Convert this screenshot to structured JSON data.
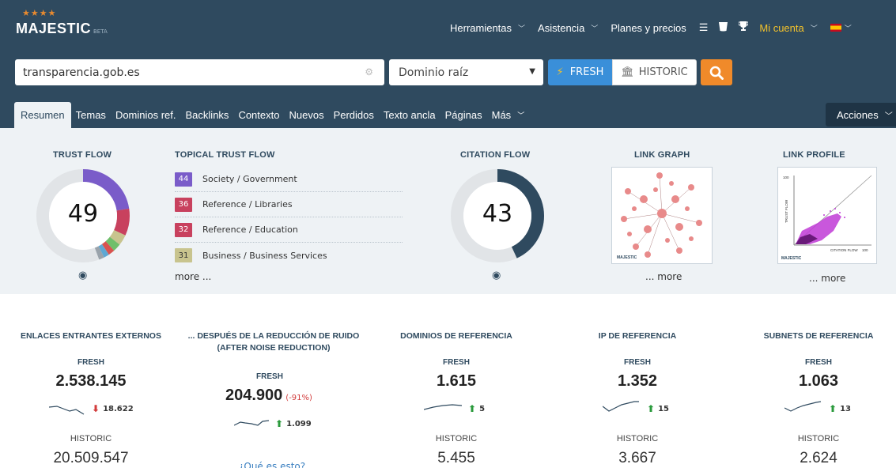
{
  "brand": {
    "name": "MAJESTIC",
    "beta": "BETA"
  },
  "topnav": {
    "tools": "Herramientas",
    "help": "Asistencia",
    "plans": "Planes y precios",
    "account": "Mi cuenta"
  },
  "search": {
    "value": "transparencia.gob.es",
    "scope": "Dominio raíz",
    "fresh": "FRESH",
    "historic": "HISTORIC"
  },
  "tabs": [
    "Resumen",
    "Temas",
    "Dominios ref.",
    "Backlinks",
    "Contexto",
    "Nuevos",
    "Perdidos",
    "Texto ancla",
    "Páginas",
    "Más"
  ],
  "actions_label": "Acciones",
  "summary": {
    "trust_flow": {
      "title": "TRUST FLOW",
      "value": "49"
    },
    "topical": {
      "title": "TOPICAL TRUST FLOW",
      "items": [
        {
          "score": "44",
          "label": "Society / Government",
          "color": "#7a5cc9"
        },
        {
          "score": "36",
          "label": "Reference / Libraries",
          "color": "#c8415e"
        },
        {
          "score": "32",
          "label": "Reference / Education",
          "color": "#c8415e"
        },
        {
          "score": "31",
          "label": "Business / Business Services",
          "color": "#c8c48e"
        }
      ],
      "more": "more ..."
    },
    "citation_flow": {
      "title": "CITATION FLOW",
      "value": "43"
    },
    "link_graph": {
      "title": "LINK GRAPH",
      "more": "... more"
    },
    "link_profile": {
      "title": "LINK PROFILE",
      "more": "... more",
      "y_axis": "TRUST FLOW",
      "x_axis": "CITATION FLOW",
      "tick": "100"
    }
  },
  "stats": [
    {
      "title": "ENLACES ENTRANTES EXTERNOS",
      "fresh_label": "FRESH",
      "fresh": "2.538.145",
      "delta": "18.622",
      "direction": "down",
      "historic_label": "HISTORIC",
      "historic": "20.509.547"
    },
    {
      "title": "... DESPUÉS DE LA REDUCCIÓN DE RUIDO (AFTER NOISE REDUCTION)",
      "fresh_label": "FRESH",
      "fresh": "204.900",
      "pct": "(-91%)",
      "delta": "1.099",
      "direction": "up",
      "what": "¿Qué es esto?"
    },
    {
      "title": "DOMINIOS DE REFERENCIA",
      "fresh_label": "FRESH",
      "fresh": "1.615",
      "delta": "5",
      "direction": "up",
      "historic_label": "HISTORIC",
      "historic": "5.455"
    },
    {
      "title": "IP DE REFERENCIA",
      "fresh_label": "FRESH",
      "fresh": "1.352",
      "delta": "15",
      "direction": "up",
      "historic_label": "HISTORIC",
      "historic": "3.667"
    },
    {
      "title": "SUBNETS DE REFERENCIA",
      "fresh_label": "FRESH",
      "fresh": "1.063",
      "delta": "13",
      "direction": "up",
      "historic_label": "HISTORIC",
      "historic": "2.624"
    }
  ]
}
